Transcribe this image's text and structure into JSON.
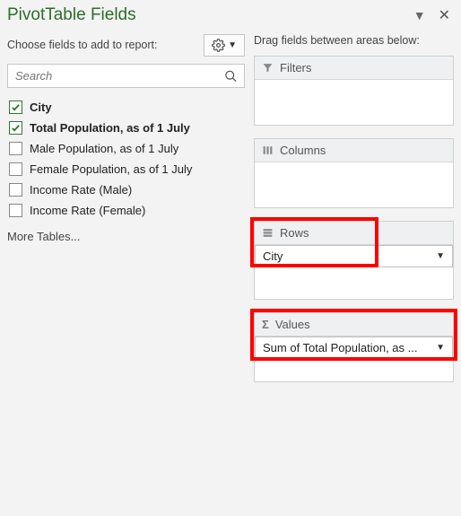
{
  "header": {
    "title": "PivotTable Fields"
  },
  "left": {
    "choose_label": "Choose fields to add to report:",
    "search_placeholder": "Search",
    "fields": [
      {
        "label": "City",
        "checked": true
      },
      {
        "label": "Total Population, as of 1 July",
        "checked": true
      },
      {
        "label": "Male Population, as of 1 July",
        "checked": false
      },
      {
        "label": "Female Population, as of 1 July",
        "checked": false
      },
      {
        "label": "Income Rate (Male)",
        "checked": false
      },
      {
        "label": "Income Rate (Female)",
        "checked": false
      }
    ],
    "more_tables": "More Tables..."
  },
  "right": {
    "drag_label": "Drag fields between areas below:",
    "filters_label": "Filters",
    "columns_label": "Columns",
    "rows_label": "Rows",
    "values_label": "Values",
    "rows_item": "City",
    "values_item": "Sum of Total Population, as ..."
  }
}
